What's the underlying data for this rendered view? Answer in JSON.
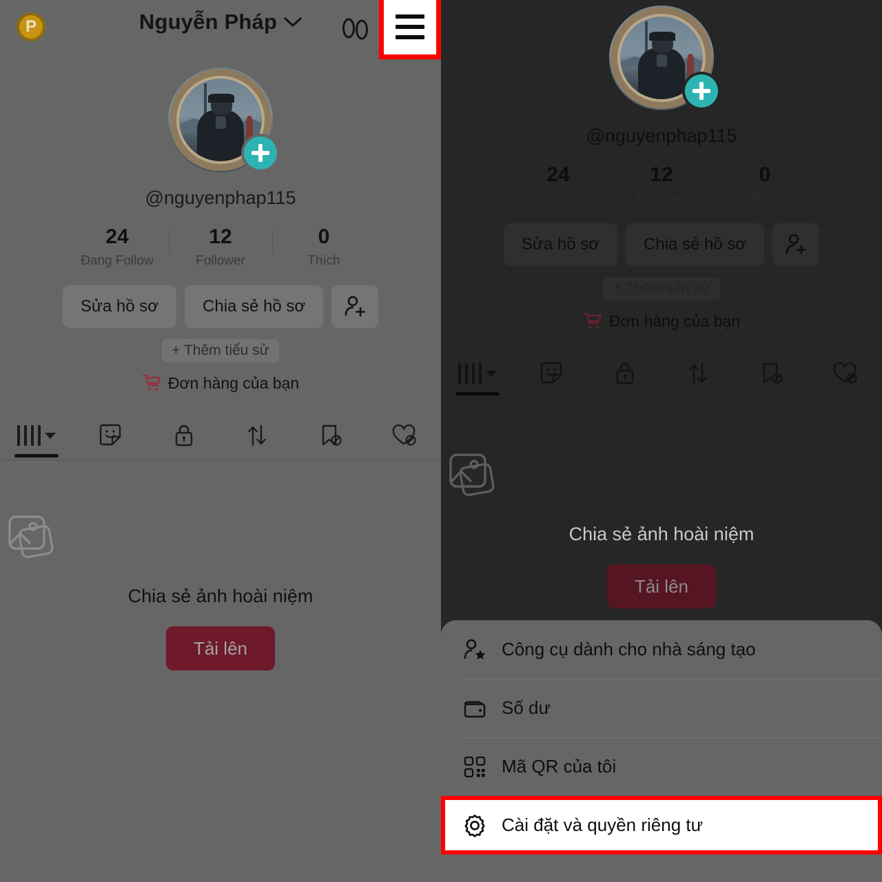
{
  "app": {
    "coin_label": "P",
    "header_title": "Nguyễn Pháp",
    "chevron_icon": "chevron-down-icon",
    "footprints_icon": "footprints-icon",
    "hamburger_icon": "hamburger-menu-icon"
  },
  "colors": {
    "left_panel_bg": "#666666",
    "right_panel_bg": "#262626",
    "sheet_bg": "#666666",
    "highlight_border": "#ff0000",
    "highlight_bg": "#ffffff",
    "upload_button": "#6e1a2b",
    "plus_badge": "#2eb3b3",
    "coin": "#c79312"
  },
  "profile": {
    "handle": "@nguyenphap115",
    "avatar_name": "profile-avatar",
    "add_story_icon": "plus-icon",
    "stats": [
      {
        "value": "24",
        "label": "Đang Follow"
      },
      {
        "value": "12",
        "label": "Follower"
      },
      {
        "value": "0",
        "label": "Thích"
      }
    ],
    "buttons": {
      "edit_profile": "Sửa hồ sơ",
      "share_profile": "Chia sẻ hồ sơ",
      "add_friend_icon": "add-person-icon"
    },
    "add_bio": "+ Thêm tiểu sử",
    "orders": "Đơn hàng của bạn",
    "orders_icon": "shopping-cart-icon"
  },
  "tabs": [
    {
      "icon": "grid-posts-icon",
      "active": true
    },
    {
      "icon": "sticker-smiley-icon",
      "active": false
    },
    {
      "icon": "lock-private-icon",
      "active": false
    },
    {
      "icon": "repost-arrows-icon",
      "active": false
    },
    {
      "icon": "bookmark-hidden-icon",
      "active": false
    },
    {
      "icon": "heart-hidden-icon",
      "active": false
    }
  ],
  "empty_state": {
    "icon": "photo-stack-icon",
    "title": "Chia sẻ ảnh hoài niệm",
    "upload_button": "Tải lên"
  },
  "menu_sheet": {
    "items": [
      {
        "icon": "creator-tools-icon",
        "label": "Công cụ dành cho nhà sáng tạo",
        "highlighted": false
      },
      {
        "icon": "wallet-icon",
        "label": "Số dư",
        "highlighted": false
      },
      {
        "icon": "qr-code-icon",
        "label": "Mã QR của tôi",
        "highlighted": false
      },
      {
        "icon": "gear-settings-icon",
        "label": "Cài đặt và quyền riêng tư",
        "highlighted": true
      }
    ]
  }
}
